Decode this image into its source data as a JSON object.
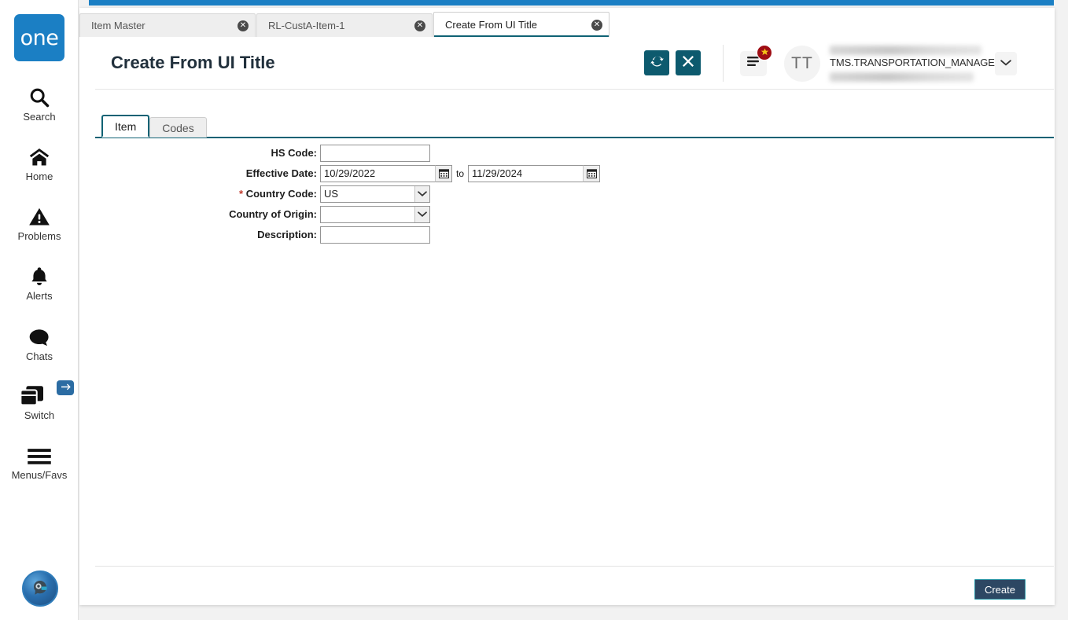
{
  "colors": {
    "brand_blue": "#1b7fc4",
    "teal_action": "#0d5a6e",
    "tab_accent": "#0f6274",
    "create_button_bg": "#2d4763",
    "create_button_border": "#2c98a8",
    "badge_red": "#9f0d14"
  },
  "rail": {
    "logo_text": "one",
    "items": [
      {
        "label": "Search",
        "icon": "search-icon"
      },
      {
        "label": "Home",
        "icon": "home-icon"
      },
      {
        "label": "Problems",
        "icon": "warning-triangle-icon"
      },
      {
        "label": "Alerts",
        "icon": "bell-icon"
      },
      {
        "label": "Chats",
        "icon": "chat-bubble-icon"
      },
      {
        "label": "Switch",
        "icon": "switch-windows-icon"
      },
      {
        "label": "Menus/Favs",
        "icon": "hamburger-icon"
      }
    ],
    "bottom_avatar_icon": "ai-assistant-avatar-icon"
  },
  "window_tabs": [
    {
      "label": "Item Master",
      "active": false,
      "close_icon": "close-circle-icon"
    },
    {
      "label": "RL-CustA-Item-1",
      "active": false,
      "close_icon": "close-circle-icon"
    },
    {
      "label": "Create From UI Title",
      "active": true,
      "close_icon": "close-circle-icon"
    }
  ],
  "header": {
    "title": "Create From UI Title",
    "refresh_icon": "refresh-icon",
    "close_icon": "x-icon",
    "menu_icon": "list-menu-icon",
    "menu_badge_icon": "star-icon",
    "avatar_initials": "TT",
    "username": "TMS.TRANSPORTATION_MANAGER",
    "caret_icon": "chevron-down-icon"
  },
  "form_tabs": [
    {
      "label": "Item",
      "active": true
    },
    {
      "label": "Codes",
      "active": false
    }
  ],
  "form": {
    "hs_code": {
      "label": "HS Code:",
      "value": "",
      "placeholder": ""
    },
    "effective_date": {
      "label": "Effective Date:",
      "from_value": "10/29/2022",
      "to_value": "11/29/2024",
      "join_text": "to",
      "calendar_icon": "calendar-icon"
    },
    "country_code": {
      "label": "Country Code:",
      "required_marker": "*",
      "value": "US",
      "arrow_icon": "chevron-down-icon"
    },
    "country_of_origin": {
      "label": "Country of Origin:",
      "value": "",
      "arrow_icon": "chevron-down-icon"
    },
    "description": {
      "label": "Description:",
      "value": "",
      "placeholder": ""
    }
  },
  "footer": {
    "create_label": "Create"
  }
}
